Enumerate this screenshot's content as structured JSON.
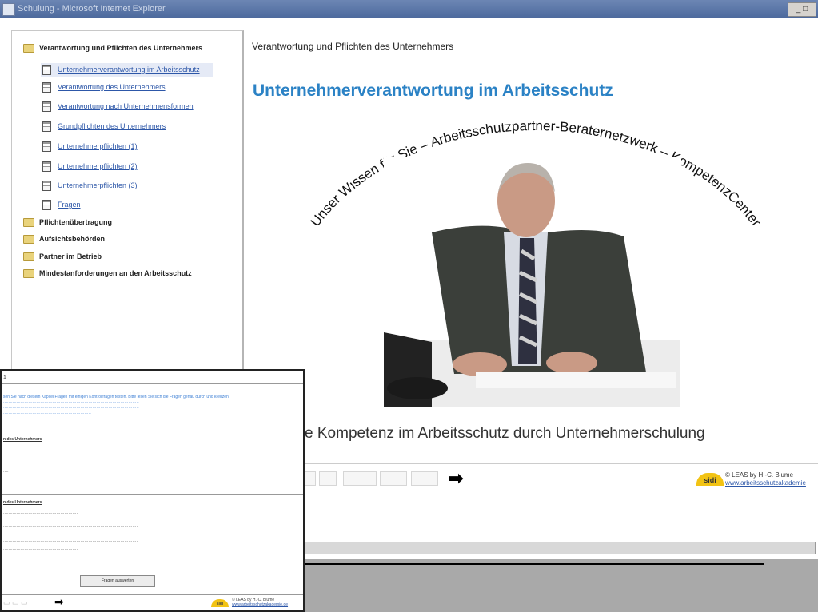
{
  "window": {
    "title": "Schulung - Microsoft Internet Explorer"
  },
  "sidebar": {
    "sections": [
      {
        "label": "Verantwortung und Pflichten des Unternehmers"
      },
      {
        "label": "Pflichtenübertragung"
      },
      {
        "label": "Aufsichtsbehörden"
      },
      {
        "label": "Partner im Betrieb"
      },
      {
        "label": "Mindestanforderungen an den Arbeitsschutz"
      }
    ],
    "items": [
      {
        "label": "Unternehmerverantwortung im Arbeitsschutz",
        "selected": true
      },
      {
        "label": "Verantwortung des Unternehmers"
      },
      {
        "label": "Verantwortung nach Unternehmensformen"
      },
      {
        "label": "Grundpflichten des Unternehmers"
      },
      {
        "label": "Unternehmerpflichten (1)"
      },
      {
        "label": "Unternehmerpflichten (2)"
      },
      {
        "label": "Unternehmerpflichten (3)"
      },
      {
        "label": "Fragen"
      }
    ]
  },
  "content": {
    "header": "Verantwortung und Pflichten des Unternehmers",
    "title": "Unternehmerverantwortung im Arbeitsschutz",
    "arc_text": "Unser Wissen für Sie – Arbeitsschutzpartner-Beraternetzwerk – KompetenzCenter",
    "subtitle": "ersönliche Kompetenz im Arbeitsschutz durch Unternehmerschulung",
    "logo": "sidi",
    "footer_line1": "© LEAS by H.-C. Blume",
    "footer_line2": "www.arbeitsschutzakademie"
  },
  "overlay": {
    "title_fragment": "1",
    "intro": "sen Sie nach diesem Kapitel Fragen mit einigen Kontrollfragen testen. Bitte lesen Sie sich die Fragen genau durch und kreuzen",
    "heading1": "n des Unternehmers",
    "heading2": "n des Unternehmers",
    "button": "Fragen auswerten",
    "footer_line1": "© LEAS by H.-C. Blume",
    "footer_line2": "www.arbeitsschutzakademie.de",
    "logo": "sidi"
  },
  "colors": {
    "accent": "#2b82c5",
    "link": "#2d57a8",
    "logo": "#f2c314"
  }
}
